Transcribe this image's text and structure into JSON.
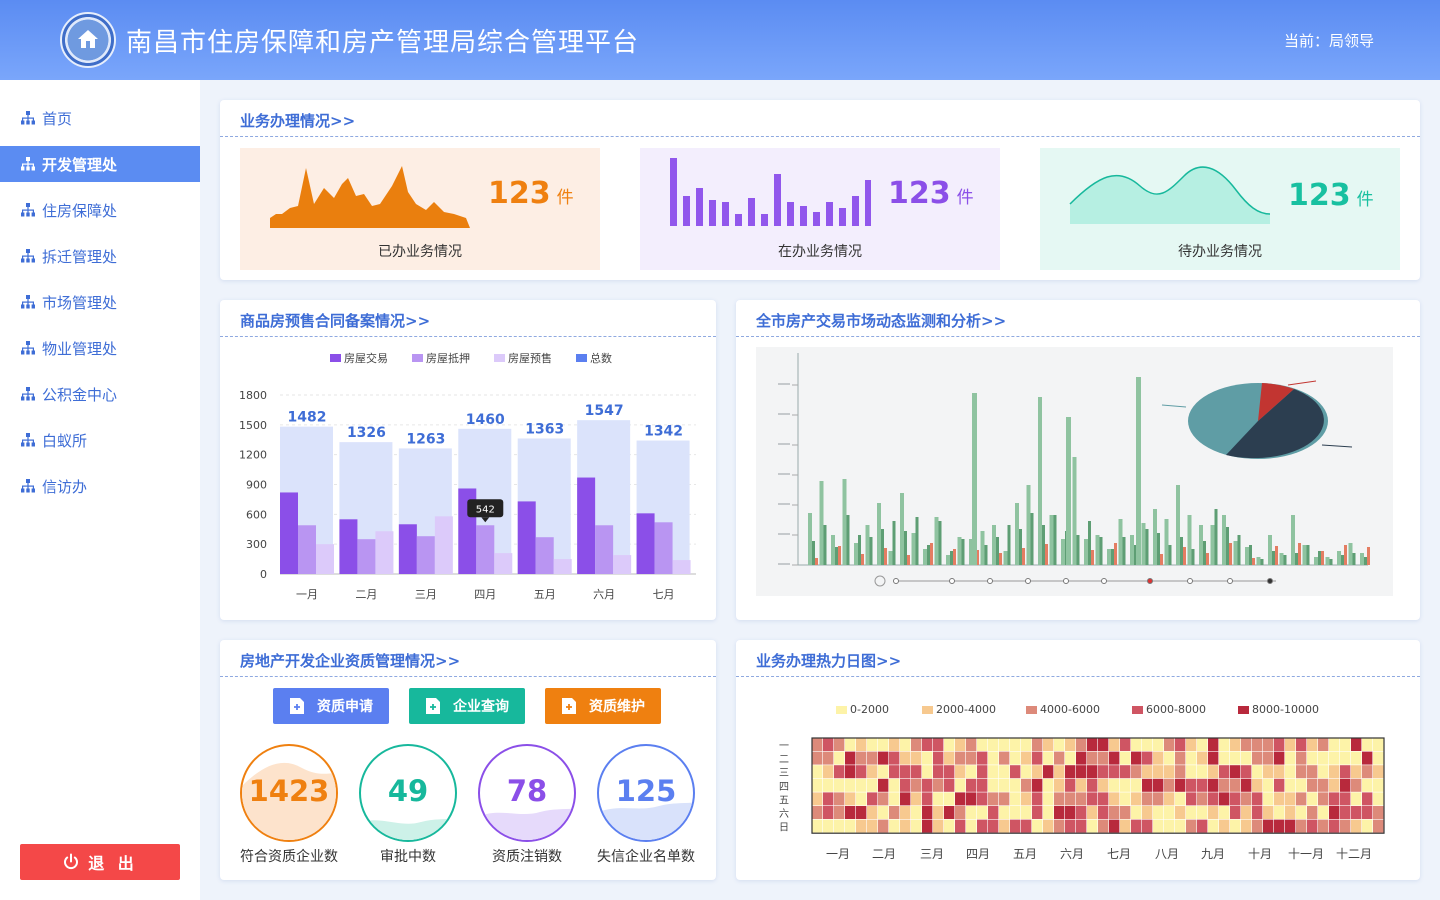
{
  "header": {
    "title": "南昌市住房保障和房产管理局综合管理平台",
    "current_user": "当前：局领导"
  },
  "sidebar": {
    "items": [
      {
        "label": "首页",
        "active": false
      },
      {
        "label": "开发管理处",
        "active": true
      },
      {
        "label": "住房保障处",
        "active": false
      },
      {
        "label": "拆迁管理处",
        "active": false
      },
      {
        "label": "市场管理处",
        "active": false
      },
      {
        "label": "物业管理处",
        "active": false
      },
      {
        "label": "公积金中心",
        "active": false
      },
      {
        "label": "白蚁所",
        "active": false
      },
      {
        "label": "信访办",
        "active": false
      }
    ],
    "logout_label": "退 出"
  },
  "business": {
    "title": "业务办理情况>>",
    "stats": [
      {
        "value": "123",
        "unit": "件",
        "label": "已办业务情况",
        "color": "#ef8010",
        "bg": "#fdeee4"
      },
      {
        "value": "123",
        "unit": "件",
        "label": "在办业务情况",
        "color": "#8b4fe8",
        "bg": "#f3eefd"
      },
      {
        "value": "123",
        "unit": "件",
        "label": "待办业务情况",
        "color": "#18c0a0",
        "bg": "#e5f8f3"
      }
    ]
  },
  "presale": {
    "title": "商品房预售合同备案情况>>",
    "tooltip": "542"
  },
  "market": {
    "title": "全市房产交易市场动态监测和分析>>"
  },
  "qualification": {
    "title": "房地产开发企业资质管理情况>>",
    "buttons": [
      {
        "label": "资质申请",
        "color": "#5b7ff0"
      },
      {
        "label": "企业查询",
        "color": "#17b89c"
      },
      {
        "label": "资质维护",
        "color": "#ef8010"
      }
    ],
    "rings": [
      {
        "value": "1423",
        "label": "符合资质企业数",
        "color": "#ef8010",
        "fill": "#fde3cc"
      },
      {
        "value": "49",
        "label": "审批中数",
        "color": "#17b89c",
        "fill": "#cdf1e8"
      },
      {
        "value": "78",
        "label": "资质注销数",
        "color": "#8b4fe8",
        "fill": "#e6dafb"
      },
      {
        "value": "125",
        "label": "失信企业名单数",
        "color": "#5b7ff0",
        "fill": "#d9e2fb"
      }
    ]
  },
  "heatmap": {
    "title": "业务办理热力日图>>",
    "legend": [
      {
        "label": "0-2000",
        "color": "#fdf3a8"
      },
      {
        "label": "2000-4000",
        "color": "#f7c98f"
      },
      {
        "label": "4000-6000",
        "color": "#dd8a7a"
      },
      {
        "label": "6000-8000",
        "color": "#cf5563"
      },
      {
        "label": "8000-10000",
        "color": "#b8293c"
      }
    ],
    "weekdays": [
      "一",
      "二",
      "三",
      "四",
      "五",
      "六",
      "日"
    ],
    "months": [
      "一月",
      "二月",
      "三月",
      "四月",
      "五月",
      "六月",
      "七月",
      "八月",
      "九月",
      "十月",
      "十一月",
      "十二月"
    ]
  },
  "chart_data": [
    {
      "type": "bar",
      "title": "商品房预售合同备案情况",
      "categories": [
        "一月",
        "二月",
        "三月",
        "四月",
        "五月",
        "六月",
        "七月"
      ],
      "series": [
        {
          "name": "房屋交易",
          "color": "#8b4fe8",
          "values": [
            820,
            550,
            500,
            860,
            730,
            970,
            610
          ]
        },
        {
          "name": "房屋抵押",
          "color": "#b995f2",
          "values": [
            490,
            350,
            380,
            490,
            370,
            490,
            520
          ]
        },
        {
          "name": "房屋预售",
          "color": "#dccafa",
          "values": [
            300,
            430,
            580,
            210,
            150,
            190,
            140
          ]
        },
        {
          "name": "总数",
          "color": "#5b7ff0",
          "values": [
            1482,
            1326,
            1263,
            1460,
            1363,
            1547,
            1342
          ]
        }
      ],
      "yticks": [
        0,
        300,
        600,
        900,
        1200,
        1500,
        1800
      ],
      "ylim": [
        0,
        1800
      ]
    }
  ]
}
